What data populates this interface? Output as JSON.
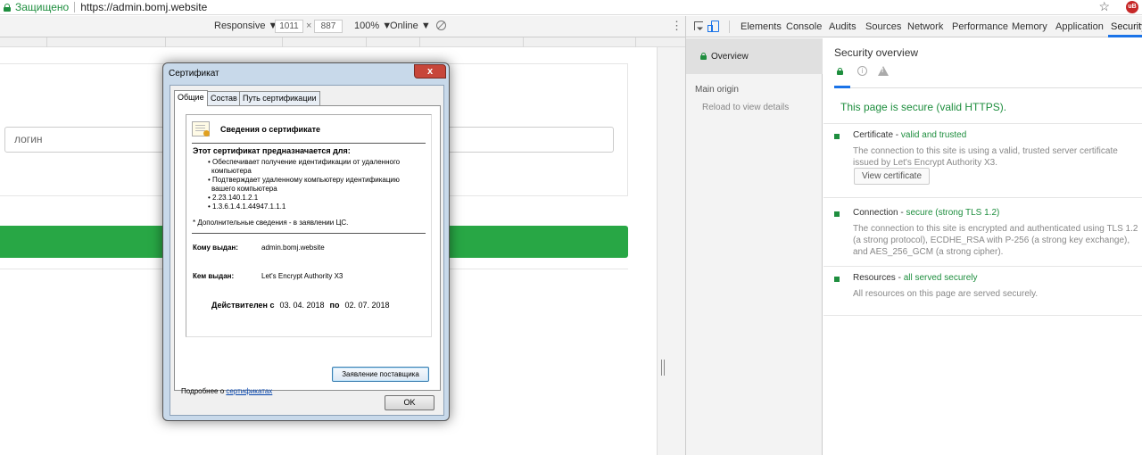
{
  "browser": {
    "secure_label": "Защищено",
    "url": "https://admin.bomj.website"
  },
  "device_toolbar": {
    "mode": "Responsive ▼",
    "width": "1011",
    "times": "×",
    "height": "887",
    "zoom": "100% ▼",
    "network": "Online ▼",
    "menu": "⋮"
  },
  "page": {
    "login_placeholder": "логин"
  },
  "devtools": {
    "tabs": [
      "Elements",
      "Console",
      "Audits",
      "Sources",
      "Network",
      "Performance",
      "Memory",
      "Application",
      "Security"
    ],
    "active_tab": "Security",
    "sidebar": {
      "overview": "Overview",
      "main_origin": "Main origin",
      "reload": "Reload to view details"
    },
    "security": {
      "title": "Security overview",
      "summary": "This page is secure (valid HTTPS).",
      "certificate": {
        "label": "Certificate - ",
        "status": "valid and trusted",
        "desc": "The connection to this site is using a valid, trusted server certificate issued by Let's Encrypt Authority X3.",
        "button": "View certificate"
      },
      "connection": {
        "label": "Connection - ",
        "status": "secure (strong TLS 1.2)",
        "desc": "The connection to this site is encrypted and authenticated using TLS 1.2 (a strong protocol), ECDHE_RSA with P-256 (a strong key exchange), and AES_256_GCM (a strong cipher)."
      },
      "resources": {
        "label": "Resources - ",
        "status": "all served securely",
        "desc": "All resources on this page are served securely."
      },
      "colors": {
        "secure": "#1e8e3e",
        "accent": "#1a73e8"
      }
    }
  },
  "cert_dialog": {
    "title": "Сертификат",
    "close": "x",
    "tabs": [
      "Общие",
      "Состав",
      "Путь сертификации"
    ],
    "info_title": "Сведения о сертификате",
    "purpose_title": "Этот сертификат предназначается для:",
    "purposes": {
      "p1a": "• Обеспечивает получение идентификации от удаленного",
      "p1b": "компьютера",
      "p2a": "• Подтверждает удаленному компьютеру идентификацию",
      "p2b": "вашего компьютера",
      "p3": "• 2.23.140.1.2.1",
      "p4": "• 1.3.6.1.4.1.44947.1.1.1"
    },
    "note": "* Дополнительные сведения - в заявлении ЦС.",
    "issued_to_label": "Кому выдан:",
    "issued_to": "admin.bomj.website",
    "issued_by_label": "Кем выдан:",
    "issued_by": "Let's Encrypt Authority X3",
    "valid_from_label": "Действителен с",
    "valid_from": "03. 04. 2018",
    "valid_to_label": "по",
    "valid_to": "02. 07. 2018",
    "issuer_statement": "Заявление поставщика",
    "more_prefix": "Подробнее о ",
    "more_link": "сертификатах",
    "ok": "OK"
  }
}
